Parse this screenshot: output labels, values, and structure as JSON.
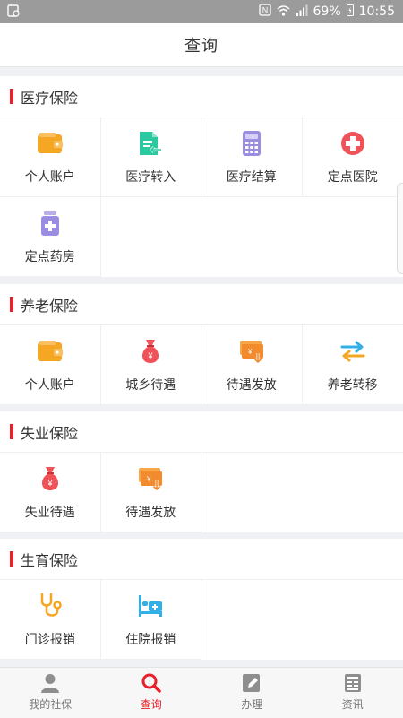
{
  "status_bar": {
    "battery_percent": "69%",
    "time": "10:55"
  },
  "header": {
    "title": "查询"
  },
  "sections": [
    {
      "title": "医疗保险",
      "items": [
        {
          "label": "个人账户",
          "icon": "wallet-icon"
        },
        {
          "label": "医疗转入",
          "icon": "document-transfer-icon"
        },
        {
          "label": "医疗结算",
          "icon": "calculator-icon"
        },
        {
          "label": "定点医院",
          "icon": "hospital-cross-icon"
        },
        {
          "label": "定点药房",
          "icon": "medicine-bottle-icon"
        }
      ]
    },
    {
      "title": "养老保险",
      "items": [
        {
          "label": "个人账户",
          "icon": "wallet-icon"
        },
        {
          "label": "城乡待遇",
          "icon": "money-bag-icon"
        },
        {
          "label": "待遇发放",
          "icon": "payment-card-icon"
        },
        {
          "label": "养老转移",
          "icon": "transfer-arrows-icon"
        }
      ]
    },
    {
      "title": "失业保险",
      "items": [
        {
          "label": "失业待遇",
          "icon": "money-bag-icon"
        },
        {
          "label": "待遇发放",
          "icon": "payment-card-icon"
        }
      ]
    },
    {
      "title": "生育保险",
      "items": [
        {
          "label": "门诊报销",
          "icon": "stethoscope-icon"
        },
        {
          "label": "住院报销",
          "icon": "hospital-bed-icon"
        }
      ]
    }
  ],
  "tabbar": {
    "items": [
      {
        "label": "我的社保",
        "icon": "user-icon"
      },
      {
        "label": "查询",
        "icon": "search-icon",
        "active": true
      },
      {
        "label": "办理",
        "icon": "edit-icon"
      },
      {
        "label": "资讯",
        "icon": "news-icon"
      }
    ]
  },
  "colors": {
    "accent": "#e62129",
    "orange": "#f5a623",
    "teal": "#2bc9a0",
    "purple": "#9b8ee0",
    "red_icon": "#f0525a",
    "blue": "#31b0e8"
  }
}
